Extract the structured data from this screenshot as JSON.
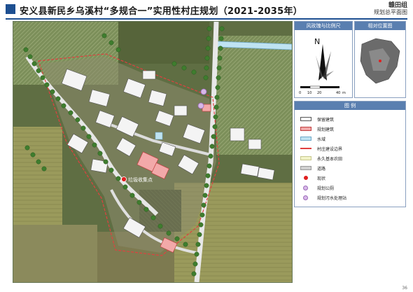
{
  "header": {
    "title": "安义县新民乡乌溪村“多规合一”实用性村庄规划（2021-2035年）",
    "group": "赣田组",
    "subtitle": "规划总平面图"
  },
  "panels": {
    "wind_title": "风玫瑰与比例尺",
    "north": "N",
    "scale_labels": [
      "0",
      "10",
      "20",
      "40"
    ],
    "scale_unit": "m",
    "location_title": "相对位置图",
    "legend_title": "图  例"
  },
  "legend": [
    {
      "label": "保留建筑",
      "color": "#ffffff",
      "border": "#555555"
    },
    {
      "label": "规划建筑",
      "color": "#f2a9a9",
      "border": "#c04040"
    },
    {
      "label": "水域",
      "color": "#bfe3f2",
      "border": "#6fa8c8"
    },
    {
      "label": "村庄建设边界",
      "color": "#e04040",
      "border": "#e04040"
    },
    {
      "label": "永久基本农田",
      "color": "#f2f3c8",
      "border": "#c8c890"
    },
    {
      "label": "道路",
      "color": "#d0d0d0",
      "border": "#9a9a9a"
    },
    {
      "label": "现状",
      "color": "#e02020",
      "border": "#e02020"
    },
    {
      "label": "规划公厕",
      "color": "#d7b8e8",
      "border": "#9b6ab8"
    },
    {
      "label": "规划污水处理站",
      "color": "#d7b8e8",
      "border": "#9b6ab8"
    }
  ],
  "map_labels": {
    "marker_text": "垃圾收集点"
  },
  "page_number": "36"
}
